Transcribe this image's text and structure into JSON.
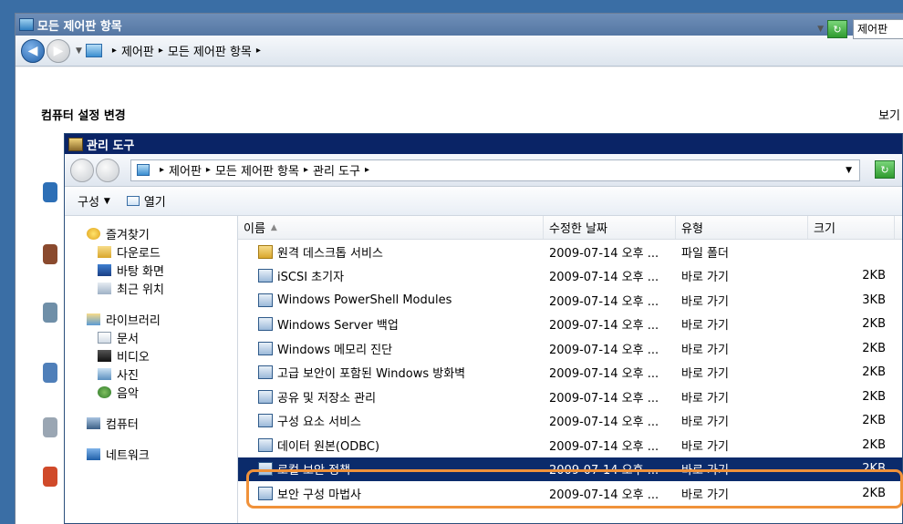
{
  "outer_window": {
    "title": "모든 제어판 항목",
    "breadcrumb": [
      "제어판",
      "모든 제어판 항목"
    ],
    "search_partial": "제어판",
    "heading": "컴퓨터 설정 변경",
    "view_partial": "보기"
  },
  "inner_window": {
    "title": "관리 도구",
    "breadcrumb": [
      "제어판",
      "모든 제어판 항목",
      "관리 도구"
    ],
    "toolbar": {
      "organize": "구성",
      "open": "열기"
    },
    "nav": {
      "favorites": {
        "label": "즐겨찾기",
        "items": [
          "다운로드",
          "바탕 화면",
          "최근 위치"
        ]
      },
      "libraries": {
        "label": "라이브러리",
        "items": [
          "문서",
          "비디오",
          "사진",
          "음악"
        ]
      },
      "computer": "컴퓨터",
      "network": "네트워크"
    },
    "columns": {
      "name": "이름",
      "date": "수정한 날짜",
      "type": "유형",
      "size": "크기"
    },
    "files": [
      {
        "name": "원격 데스크톱 서비스",
        "date": "2009-07-14 오후 ...",
        "type": "파일 폴더",
        "size": ""
      },
      {
        "name": "iSCSI 초기자",
        "date": "2009-07-14 오후 ...",
        "type": "바로 가기",
        "size": "2KB"
      },
      {
        "name": "Windows PowerShell Modules",
        "date": "2009-07-14 오후 ...",
        "type": "바로 가기",
        "size": "3KB"
      },
      {
        "name": "Windows Server 백업",
        "date": "2009-07-14 오후 ...",
        "type": "바로 가기",
        "size": "2KB"
      },
      {
        "name": "Windows 메모리 진단",
        "date": "2009-07-14 오후 ...",
        "type": "바로 가기",
        "size": "2KB"
      },
      {
        "name": "고급 보안이 포함된 Windows 방화벽",
        "date": "2009-07-14 오후 ...",
        "type": "바로 가기",
        "size": "2KB"
      },
      {
        "name": "공유 및 저장소 관리",
        "date": "2009-07-14 오후 ...",
        "type": "바로 가기",
        "size": "2KB"
      },
      {
        "name": "구성 요소 서비스",
        "date": "2009-07-14 오후 ...",
        "type": "바로 가기",
        "size": "2KB"
      },
      {
        "name": "데이터 원본(ODBC)",
        "date": "2009-07-14 오후 ...",
        "type": "바로 가기",
        "size": "2KB"
      },
      {
        "name": "로컬 보안 정책",
        "date": "2009-07-14 오후 ...",
        "type": "바로 가기",
        "size": "2KB"
      },
      {
        "name": "보안 구성 마법사",
        "date": "2009-07-14 오후 ...",
        "type": "바로 가기",
        "size": "2KB"
      }
    ],
    "selected_index": 9
  },
  "colors": {
    "highlight_ring": "#f0923a",
    "selection": "#0b2b6b",
    "titlebar": "#0a2466"
  }
}
